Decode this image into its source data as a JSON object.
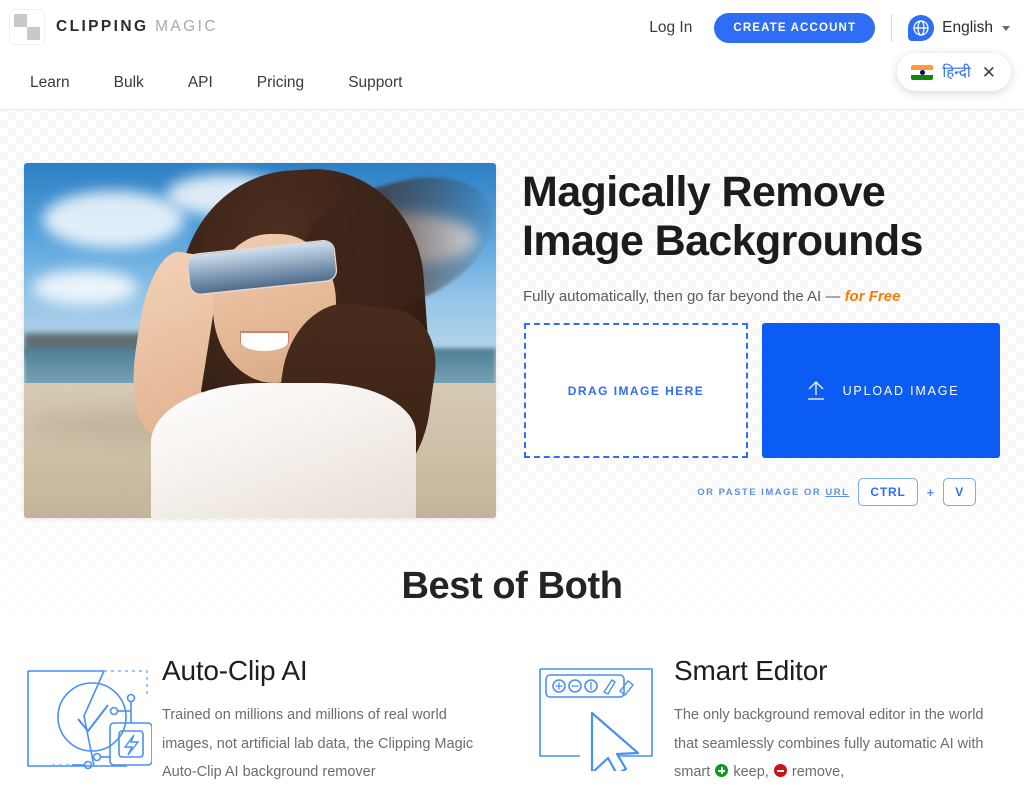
{
  "brand": {
    "mark_icon": "checkerboard-logo-icon",
    "name_bold": "CLIPPING",
    "name_light": "MAGIC"
  },
  "nav": {
    "items": [
      {
        "label": "Learn"
      },
      {
        "label": "Bulk"
      },
      {
        "label": "API"
      },
      {
        "label": "Pricing"
      },
      {
        "label": "Support"
      }
    ]
  },
  "header": {
    "login_label": "Log In",
    "create_account_label": "CREATE ACCOUNT",
    "language_label": "English",
    "globe_icon": "globe-icon",
    "caret_icon": "chevron-down-icon"
  },
  "language_suggestion": {
    "flag_icon": "india-flag-icon",
    "label": "हिन्दी",
    "close_icon": "close-icon"
  },
  "hero": {
    "photo_alt": "smiling woman on beach wearing sunglasses",
    "title_line1": "Magically Remove",
    "title_line2": "Image Backgrounds",
    "subtitle_prefix": "Fully automatically, then go far beyond the AI — ",
    "subtitle_highlight": "for Free",
    "dropzone_label": "DRAG IMAGE HERE",
    "upload_label": "UPLOAD IMAGE",
    "upload_icon": "upload-arrow-icon",
    "paste_prefix": "OR PASTE IMAGE OR ",
    "paste_url_word": "URL",
    "key_ctrl": "CTRL",
    "key_plus": "+",
    "key_v": "V"
  },
  "best_of_both": {
    "title": "Best of Both",
    "features": [
      {
        "icon": "auto-clip-ai-icon",
        "title": "Auto-Clip AI",
        "text": "Trained on millions and millions of real world images, not artificial lab data, the Clipping Magic Auto-Clip AI background remover"
      },
      {
        "icon": "smart-editor-icon",
        "title": "Smart Editor",
        "text_part1": "The only background removal editor in the world that seamlessly combines fully automatic AI with smart ",
        "keep_word": "keep,",
        "remove_word": "remove,",
        "keep_icon": "keep-plus-icon",
        "remove_icon": "remove-minus-icon"
      }
    ]
  },
  "colors": {
    "accent_blue": "#0a5cf5",
    "button_blue": "#2f6df6",
    "free_orange": "#f57c00",
    "keep_green": "#0a9b1e",
    "remove_red": "#cc1111"
  }
}
